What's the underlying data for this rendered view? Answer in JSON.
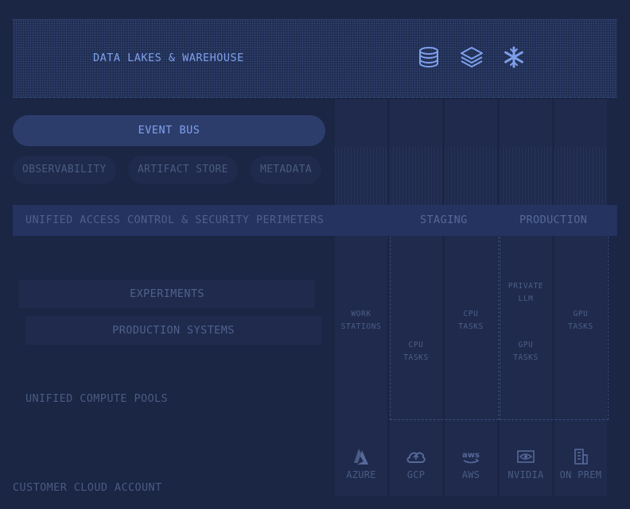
{
  "lake": {
    "label": "DATA LAKES & WAREHOUSE",
    "icons": [
      "database-icon",
      "layers-icon",
      "snowflake-icon"
    ]
  },
  "event_bus": {
    "label": "EVENT BUS"
  },
  "services": [
    "OBSERVABILITY",
    "ARTIFACT STORE",
    "METADATA"
  ],
  "access": {
    "label": "UNIFIED ACCESS CONTROL & SECURITY PERIMETERS",
    "staging": "STAGING",
    "production": "PRODUCTION"
  },
  "compute": {
    "experiments": "EXPERIMENTS",
    "production_systems": "PRODUCTION SYSTEMS",
    "pools": "UNIFIED COMPUTE POOLS"
  },
  "providers": [
    {
      "name": "AZURE",
      "icon": "azure-icon",
      "tasks": [
        {
          "line1": "WORK",
          "line2": "STATIONS"
        }
      ]
    },
    {
      "name": "GCP",
      "icon": "gcp-cloud-icon",
      "tasks": [
        {
          "line1": "CPU",
          "line2": "TASKS"
        }
      ]
    },
    {
      "name": "AWS",
      "icon": "aws-icon",
      "tasks": [
        {
          "line1": "CPU",
          "line2": "TASKS"
        }
      ]
    },
    {
      "name": "NVIDIA",
      "icon": "nvidia-icon",
      "tasks": [
        {
          "line1": "PRIVATE",
          "line2": "LLM"
        },
        {
          "line1": "GPU",
          "line2": "TASKS"
        }
      ]
    },
    {
      "name": "ON PREM",
      "icon": "building-icon",
      "tasks": [
        {
          "line1": "GPU",
          "line2": "TASKS"
        }
      ]
    }
  ],
  "account": {
    "label": "CUSTOMER CLOUD ACCOUNT"
  },
  "colors": {
    "background": "#1b2544",
    "accent": "#7ea0ec",
    "muted": "#4b5b82"
  }
}
